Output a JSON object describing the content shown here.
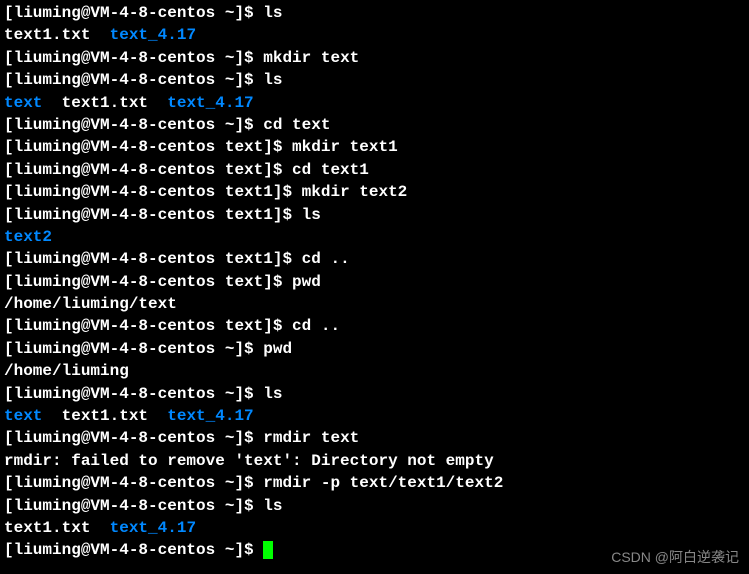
{
  "lines": [
    {
      "prompt": "[liuming@VM-4-8-centos ~]$ ",
      "cmd": "ls"
    },
    {
      "output": [
        {
          "t": "text1.txt  ",
          "c": ""
        },
        {
          "t": "text_4.17",
          "c": "dir"
        }
      ]
    },
    {
      "prompt": "[liuming@VM-4-8-centos ~]$ ",
      "cmd": "mkdir text"
    },
    {
      "prompt": "[liuming@VM-4-8-centos ~]$ ",
      "cmd": "ls"
    },
    {
      "output": [
        {
          "t": "text",
          "c": "dir"
        },
        {
          "t": "  text1.txt  ",
          "c": ""
        },
        {
          "t": "text_4.17",
          "c": "dir"
        }
      ]
    },
    {
      "prompt": "[liuming@VM-4-8-centos ~]$ ",
      "cmd": "cd text"
    },
    {
      "prompt": "[liuming@VM-4-8-centos text]$ ",
      "cmd": "mkdir text1"
    },
    {
      "prompt": "[liuming@VM-4-8-centos text]$ ",
      "cmd": "cd text1"
    },
    {
      "prompt": "[liuming@VM-4-8-centos text1]$ ",
      "cmd": "mkdir text2"
    },
    {
      "prompt": "[liuming@VM-4-8-centos text1]$ ",
      "cmd": "ls"
    },
    {
      "output": [
        {
          "t": "text2",
          "c": "dir"
        }
      ]
    },
    {
      "prompt": "[liuming@VM-4-8-centos text1]$ ",
      "cmd": "cd .."
    },
    {
      "prompt": "[liuming@VM-4-8-centos text]$ ",
      "cmd": "pwd"
    },
    {
      "output": [
        {
          "t": "/home/liuming/text",
          "c": ""
        }
      ]
    },
    {
      "prompt": "[liuming@VM-4-8-centos text]$ ",
      "cmd": "cd .."
    },
    {
      "prompt": "[liuming@VM-4-8-centos ~]$ ",
      "cmd": "pwd"
    },
    {
      "output": [
        {
          "t": "/home/liuming",
          "c": ""
        }
      ]
    },
    {
      "prompt": "[liuming@VM-4-8-centos ~]$ ",
      "cmd": "ls"
    },
    {
      "output": [
        {
          "t": "text",
          "c": "dir"
        },
        {
          "t": "  text1.txt  ",
          "c": ""
        },
        {
          "t": "text_4.17",
          "c": "dir"
        }
      ]
    },
    {
      "prompt": "[liuming@VM-4-8-centos ~]$ ",
      "cmd": "rmdir text"
    },
    {
      "output": [
        {
          "t": "rmdir: failed to remove 'text': Directory not empty",
          "c": ""
        }
      ]
    },
    {
      "prompt": "[liuming@VM-4-8-centos ~]$ ",
      "cmd": "rmdir -p text/text1/text2"
    },
    {
      "prompt": "[liuming@VM-4-8-centos ~]$ ",
      "cmd": "ls"
    },
    {
      "output": [
        {
          "t": "text1.txt  ",
          "c": ""
        },
        {
          "t": "text_4.17",
          "c": "dir"
        }
      ]
    },
    {
      "prompt": "[liuming@VM-4-8-centos ~]$ ",
      "cmd": "",
      "cursor": true
    }
  ],
  "watermark": "CSDN @阿白逆袭记"
}
